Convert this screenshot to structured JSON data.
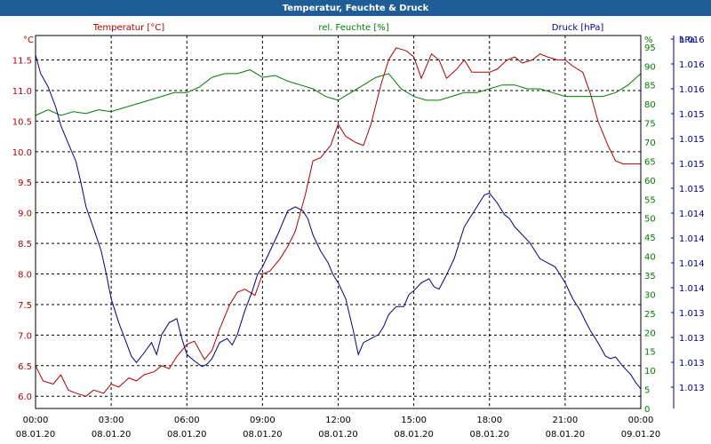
{
  "chart_data": {
    "type": "line",
    "title": "Temperatur, Feuchte & Druck",
    "colors": {
      "temperature": "#b00000",
      "humidity": "#007a00",
      "pressure": "#00008b",
      "title_bar": "#1f5d96"
    },
    "x_ticks": [
      {
        "time": "00:00",
        "date": "08.01.20"
      },
      {
        "time": "03:00",
        "date": "08.01.20"
      },
      {
        "time": "06:00",
        "date": "08.01.20"
      },
      {
        "time": "09:00",
        "date": "08.01.20"
      },
      {
        "time": "12:00",
        "date": "08.01.20"
      },
      {
        "time": "15:00",
        "date": "08.01.20"
      },
      {
        "time": "18:00",
        "date": "08.01.20"
      },
      {
        "time": "21:00",
        "date": "08.01.20"
      },
      {
        "time": "00:00",
        "date": "09.01.20"
      }
    ],
    "xlim_hours": [
      0,
      24
    ],
    "axes": {
      "temperature": {
        "unit": "°C",
        "legend": "rel. Feuchte [%]",
        "label": "Temperatur [°C]",
        "ylim": [
          5.8,
          11.9
        ],
        "ticks": [
          "6.0",
          "6.5",
          "7.0",
          "7.5",
          "8.0",
          "8.5",
          "9.0",
          "9.5",
          "10.0",
          "10.5",
          "11.0",
          "11.5"
        ]
      },
      "humidity": {
        "unit": "%",
        "label": "rel. Feuchte [%]",
        "ylim": [
          0,
          98
        ],
        "ticks": [
          "0",
          "5",
          "10",
          "15",
          "20",
          "25",
          "30",
          "35",
          "40",
          "45",
          "50",
          "55",
          "60",
          "65",
          "70",
          "75",
          "80",
          "85",
          "90",
          "95",
          "%"
        ]
      },
      "pressure": {
        "unit": "hPa",
        "label": "Druck [hPa]",
        "ticks": [
          "1.013",
          "1.013",
          "1.013",
          "1.013",
          "1.014",
          "1.014",
          "1.014",
          "1.014",
          "1.015",
          "1.015",
          "1.015",
          "1.015",
          "1.016",
          "1.016",
          "1.016",
          "hPa"
        ]
      }
    },
    "series": [
      {
        "name": "Temperatur [°C]",
        "axis": "temperature",
        "x": [
          0,
          0.3,
          0.7,
          1.0,
          1.3,
          1.6,
          2.0,
          2.3,
          2.7,
          3.0,
          3.3,
          3.7,
          4.0,
          4.3,
          4.7,
          5.0,
          5.3,
          5.6,
          6.0,
          6.3,
          6.7,
          7.0,
          7.3,
          7.7,
          8.0,
          8.3,
          8.7,
          9.0,
          9.3,
          9.7,
          10.0,
          10.3,
          10.7,
          11.0,
          11.3,
          11.7,
          12.0,
          12.3,
          12.7,
          13.0,
          13.3,
          13.7,
          14.0,
          14.3,
          14.7,
          15.0,
          15.3,
          15.7,
          16.0,
          16.3,
          16.7,
          17.0,
          17.3,
          17.7,
          18.0,
          18.3,
          18.7,
          19.0,
          19.3,
          19.7,
          20.0,
          20.3,
          20.7,
          21.0,
          21.3,
          21.7,
          22.0,
          22.3,
          22.7,
          23.0,
          23.3,
          23.7,
          24.0
        ],
        "values": [
          6.5,
          6.25,
          6.2,
          6.35,
          6.1,
          6.05,
          6.0,
          6.1,
          6.05,
          6.2,
          6.15,
          6.3,
          6.25,
          6.35,
          6.4,
          6.5,
          6.45,
          6.65,
          6.85,
          6.9,
          6.6,
          6.75,
          7.1,
          7.5,
          7.7,
          7.75,
          7.65,
          8.0,
          8.05,
          8.25,
          8.45,
          8.7,
          9.3,
          9.85,
          9.9,
          10.1,
          10.45,
          10.25,
          10.15,
          10.1,
          10.45,
          11.1,
          11.5,
          11.7,
          11.65,
          11.55,
          11.2,
          11.6,
          11.5,
          11.2,
          11.35,
          11.5,
          11.3,
          11.3,
          11.3,
          11.35,
          11.5,
          11.55,
          11.45,
          11.5,
          11.6,
          11.55,
          11.5,
          11.5,
          11.4,
          11.3,
          10.95,
          10.5,
          10.1,
          9.85,
          9.8,
          9.8,
          9.8
        ]
      },
      {
        "name": "rel. Feuchte [%]",
        "axis": "humidity",
        "x": [
          0,
          0.5,
          1.0,
          1.5,
          2.0,
          2.5,
          3.0,
          3.5,
          4.0,
          4.5,
          5.0,
          5.5,
          6.0,
          6.5,
          7.0,
          7.5,
          8.0,
          8.5,
          9.0,
          9.5,
          10.0,
          10.5,
          11.0,
          11.5,
          12.0,
          12.5,
          13.0,
          13.5,
          14.0,
          14.5,
          15.0,
          15.5,
          16.0,
          16.5,
          17.0,
          17.5,
          18.0,
          18.5,
          19.0,
          19.5,
          20.0,
          20.5,
          21.0,
          21.5,
          22.0,
          22.5,
          23.0,
          23.5,
          24.0
        ],
        "values": [
          77,
          78.5,
          77,
          78,
          77.5,
          78.5,
          78,
          79,
          80,
          81,
          82,
          83,
          83,
          84.5,
          87,
          88,
          88,
          89,
          87,
          87.5,
          86,
          85,
          84,
          82,
          81,
          83,
          85,
          87,
          88,
          84,
          82,
          81,
          81,
          82,
          83,
          83,
          84,
          85,
          85,
          84,
          84,
          83,
          82,
          82,
          82,
          82,
          83,
          85,
          88
        ]
      },
      {
        "name": "Druck [hPa]",
        "axis": "pressure",
        "x": [
          0,
          0.2,
          0.5,
          0.8,
          1.0,
          1.3,
          1.6,
          1.8,
          2.0,
          2.3,
          2.6,
          2.8,
          3.0,
          3.3,
          3.6,
          3.8,
          4.0,
          4.3,
          4.6,
          4.8,
          5.0,
          5.3,
          5.6,
          5.8,
          6.0,
          6.3,
          6.6,
          6.8,
          7.0,
          7.3,
          7.6,
          7.8,
          8.0,
          8.3,
          8.6,
          8.8,
          9.0,
          9.3,
          9.6,
          9.8,
          10.0,
          10.3,
          10.6,
          10.8,
          11.0,
          11.3,
          11.6,
          11.8,
          12.0,
          12.3,
          12.6,
          12.8,
          13.0,
          13.3,
          13.6,
          13.8,
          14.0,
          14.3,
          14.6,
          14.8,
          15.0,
          15.3,
          15.6,
          15.8,
          16.0,
          16.3,
          16.6,
          16.8,
          17.0,
          17.3,
          17.6,
          17.8,
          18.0,
          18.3,
          18.6,
          18.8,
          19.0,
          19.3,
          19.6,
          19.8,
          20.0,
          20.3,
          20.6,
          20.8,
          21.0,
          21.3,
          21.6,
          21.8,
          22.0,
          22.3,
          22.6,
          22.8,
          23.0,
          23.3,
          23.6,
          23.8,
          24.0
        ],
        "values": [
          1.01705,
          1.01682,
          1.01665,
          1.0164,
          1.01617,
          1.01594,
          1.01572,
          1.01545,
          1.01515,
          1.01488,
          1.0146,
          1.01432,
          1.014,
          1.0137,
          1.01345,
          1.01328,
          1.0132,
          1.01332,
          1.01345,
          1.0133,
          1.01355,
          1.0137,
          1.01375,
          1.0135,
          1.0133,
          1.01322,
          1.01315,
          1.01318,
          1.01325,
          1.01345,
          1.0135,
          1.01342,
          1.01355,
          1.01385,
          1.0141,
          1.0143,
          1.0144,
          1.0146,
          1.0148,
          1.01495,
          1.0151,
          1.01515,
          1.0151,
          1.015,
          1.0148,
          1.0146,
          1.01445,
          1.0143,
          1.0142,
          1.014,
          1.0136,
          1.0133,
          1.01345,
          1.0135,
          1.01355,
          1.01365,
          1.0138,
          1.0139,
          1.0139,
          1.01405,
          1.0141,
          1.0142,
          1.01425,
          1.01415,
          1.01412,
          1.0143,
          1.0145,
          1.0147,
          1.0149,
          1.01505,
          1.0152,
          1.0153,
          1.01532,
          1.0152,
          1.01505,
          1.015,
          1.0149,
          1.0148,
          1.0147,
          1.0146,
          1.0145,
          1.01445,
          1.0144,
          1.0143,
          1.0142,
          1.014,
          1.01385,
          1.01372,
          1.0136,
          1.01345,
          1.01328,
          1.01325,
          1.01327,
          1.01315,
          1.01305,
          1.01295,
          1.01287
        ]
      }
    ]
  }
}
